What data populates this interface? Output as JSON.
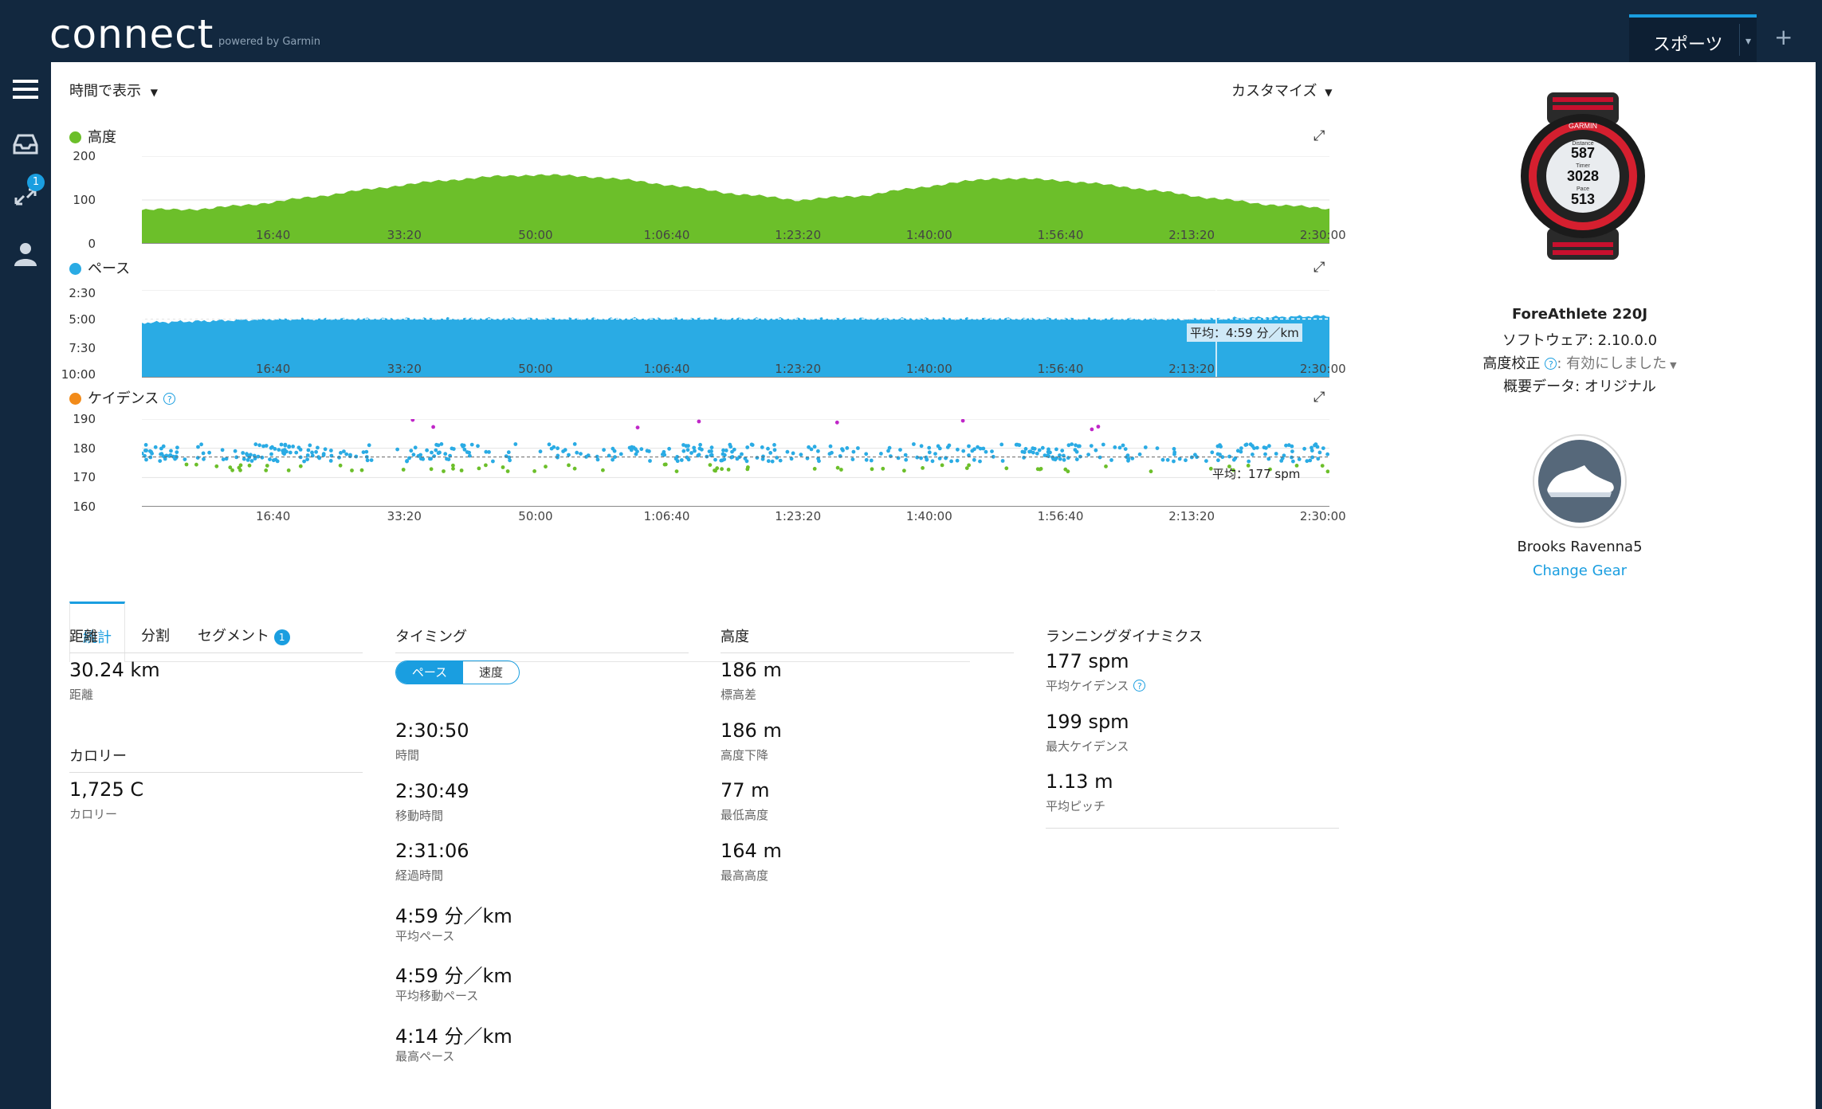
{
  "header": {
    "logo": "connect",
    "logo_sub": "powered by Garmin",
    "sport_tab": "スポーツ",
    "add_tab": "+"
  },
  "sidebar": {
    "badge": "1"
  },
  "toolbar": {
    "view_by": "時間で表示",
    "customize": "カスタマイズ"
  },
  "charts": {
    "elevation": {
      "title": "高度",
      "y_ticks": [
        "200",
        "100",
        "0"
      ],
      "x_ticks": [
        "16:40",
        "33:20",
        "50:00",
        "1:06:40",
        "1:23:20",
        "1:40:00",
        "1:56:40",
        "2:13:20",
        "2:30:00"
      ],
      "color": "#6cbf2a"
    },
    "pace": {
      "title": "ペース",
      "y_ticks": [
        "2:30",
        "5:00",
        "7:30",
        "10:00"
      ],
      "x_ticks": [
        "16:40",
        "33:20",
        "50:00",
        "1:06:40",
        "1:23:20",
        "1:40:00",
        "1:56:40",
        "2:13:20",
        "2:30:00"
      ],
      "avg_label": "平均：4:59 分／km",
      "color": "#2aabe4"
    },
    "cadence": {
      "title": "ケイデンス",
      "y_ticks": [
        "190",
        "180",
        "170",
        "160"
      ],
      "x_ticks": [
        "16:40",
        "33:20",
        "50:00",
        "1:06:40",
        "1:23:20",
        "1:40:00",
        "1:56:40",
        "2:13:20",
        "2:30:00"
      ],
      "avg_label": "平均：177 spm",
      "color": "#f28b1a"
    }
  },
  "chart_data": [
    {
      "type": "area",
      "title": "高度",
      "x": [
        "0:00",
        "8:20",
        "16:40",
        "25:00",
        "33:20",
        "41:40",
        "50:00",
        "58:20",
        "1:06:40",
        "1:15:00",
        "1:23:20",
        "1:31:40",
        "1:40:00",
        "1:48:20",
        "1:56:40",
        "2:05:00",
        "2:13:20",
        "2:21:40",
        "2:30:50"
      ],
      "values": [
        77,
        80,
        95,
        115,
        135,
        150,
        158,
        152,
        135,
        115,
        100,
        110,
        132,
        150,
        145,
        130,
        110,
        92,
        80
      ],
      "ylim": [
        0,
        200
      ]
    },
    {
      "type": "area",
      "title": "ペース",
      "x": [
        "0:00",
        "16:40",
        "33:20",
        "50:00",
        "1:06:40",
        "1:23:20",
        "1:40:00",
        "1:56:40",
        "2:13:20",
        "2:30:50"
      ],
      "values": [
        5.3,
        5.0,
        4.95,
        4.95,
        4.95,
        4.95,
        4.95,
        4.95,
        5.0,
        4.7
      ],
      "average": 4.98,
      "ylim": [
        2.5,
        10.0
      ]
    },
    {
      "type": "scatter",
      "title": "ケイデンス",
      "x_range": [
        "0:00",
        "2:30:50"
      ],
      "average": 177,
      "typical_range": [
        172,
        182
      ],
      "ylim": [
        160,
        190
      ]
    }
  ],
  "tabs": [
    {
      "label": "統計"
    },
    {
      "label": "分割"
    },
    {
      "label": "セグメント"
    }
  ],
  "segment_badge": "1",
  "stats": {
    "distance": {
      "heading": "距離",
      "items": [
        {
          "value": "30.24 km",
          "label": "距離"
        }
      ]
    },
    "calories": {
      "heading": "カロリー",
      "items": [
        {
          "value": "1,725 C",
          "label": "カロリー"
        }
      ]
    },
    "timing": {
      "heading": "タイミング",
      "toggle": [
        "ペース",
        "速度"
      ],
      "items": [
        {
          "value": "2:30:50",
          "label": "時間"
        },
        {
          "value": "2:30:49",
          "label": "移動時間"
        },
        {
          "value": "2:31:06",
          "label": "経過時間"
        },
        {
          "value": "4:59 分／km",
          "label": "平均ペース"
        },
        {
          "value": "4:59 分／km",
          "label": "平均移動ペース"
        },
        {
          "value": "4:14 分／km",
          "label": "最高ペース"
        }
      ]
    },
    "elevation": {
      "heading": "高度",
      "items": [
        {
          "value": "186 m",
          "label": "標高差"
        },
        {
          "value": "186 m",
          "label": "高度下降"
        },
        {
          "value": "77 m",
          "label": "最低高度"
        },
        {
          "value": "164 m",
          "label": "最高高度"
        }
      ]
    },
    "running_dynamics": {
      "heading": "ランニングダイナミクス",
      "items": [
        {
          "value": "177 spm",
          "label": "平均ケイデンス"
        },
        {
          "value": "199 spm",
          "label": "最大ケイデンス"
        },
        {
          "value": "1.13 m",
          "label": "平均ピッチ"
        }
      ]
    }
  },
  "device": {
    "name": "ForeAthlete 220J",
    "software": "ソフトウェア: 2.10.0.0",
    "alt_calib_label": "高度校正",
    "alt_calib_value": ": 有効にしました",
    "summary": "概要データ: オリジナル",
    "watch_brand": "GARMIN",
    "watch_lines": [
      {
        "label": "Distance",
        "value": "587"
      },
      {
        "label": "Timer",
        "value": "3028"
      },
      {
        "label": "Pace",
        "value": "513"
      }
    ]
  },
  "gear": {
    "name": "Brooks Ravenna5",
    "change": "Change Gear"
  }
}
